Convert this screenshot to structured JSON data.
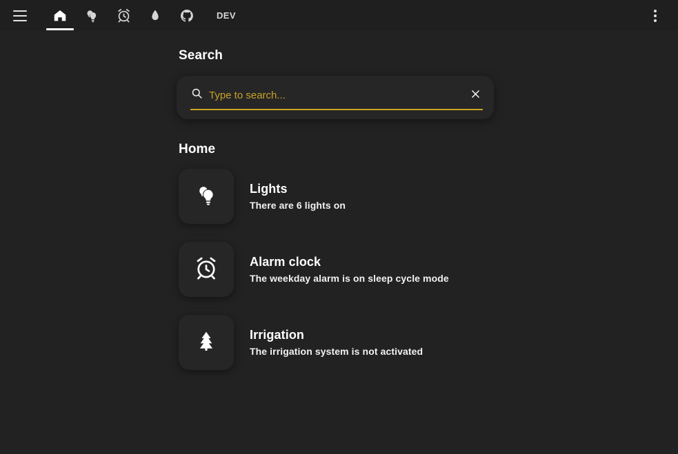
{
  "colors": {
    "page_background": "#222222",
    "appbar_background": "#1f1f1f",
    "card_background": "#262626",
    "accent": "#c9a227",
    "text_primary": "#ffffff",
    "icon": "#e3e3e3"
  },
  "appbar": {
    "menu_button": "menu-icon",
    "nav_items": [
      {
        "icon": "home-icon",
        "label": "Home",
        "active": true
      },
      {
        "icon": "lightbulb-icon",
        "label": "Lights",
        "active": false
      },
      {
        "icon": "alarm-clock-icon",
        "label": "Alarm clock",
        "active": false
      },
      {
        "icon": "water-drop-icon",
        "label": "Irrigation",
        "active": false
      },
      {
        "icon": "github-icon",
        "label": "GitHub",
        "active": false
      }
    ],
    "dev_label": "DEV",
    "overflow_button": "more-vertical-icon"
  },
  "search": {
    "title": "Search",
    "placeholder": "Type to search...",
    "value": "",
    "icon": "search-icon",
    "clear_icon": "close-icon"
  },
  "home": {
    "title": "Home",
    "items": [
      {
        "icon": "lightbulb-group-icon",
        "name": "Lights",
        "state": "There are 6 lights on"
      },
      {
        "icon": "alarm-clock-icon",
        "name": "Alarm clock",
        "state": "The weekday alarm is on sleep cycle mode"
      },
      {
        "icon": "park-tree-icon",
        "name": "Irrigation",
        "state": "The irrigation system is not activated"
      }
    ]
  }
}
